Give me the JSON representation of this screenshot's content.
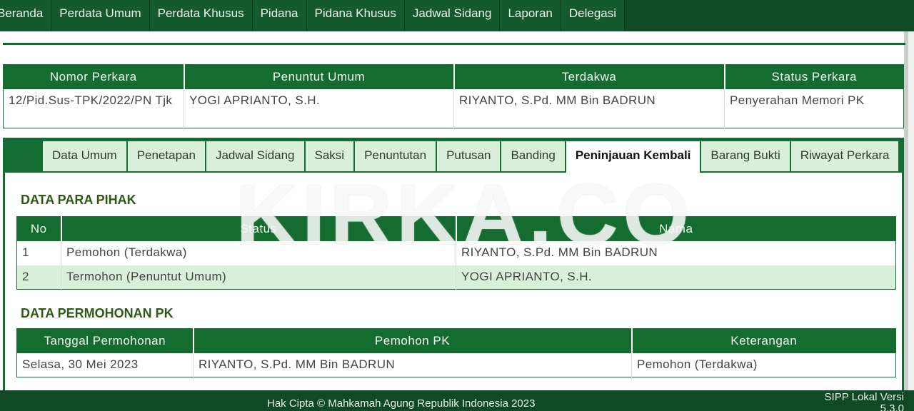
{
  "nav": {
    "items": [
      "Beranda",
      "Perdata Umum",
      "Perdata Khusus",
      "Pidana",
      "Pidana Khusus",
      "Jadwal Sidang",
      "Laporan",
      "Delegasi"
    ]
  },
  "case": {
    "headers": [
      "Nomor Perkara",
      "Penuntut Umum",
      "Terdakwa",
      "Status Perkara"
    ],
    "row": [
      "12/Pid.Sus-TPK/2022/PN Tjk",
      "YOGI APRIANTO, S.H.",
      "RIYANTO, S.Pd. MM Bin BADRUN",
      "Penyerahan Memori PK"
    ]
  },
  "tabs": {
    "items": [
      "Data Umum",
      "Penetapan",
      "Jadwal Sidang",
      "Saksi",
      "Penuntutan",
      "Putusan",
      "Banding",
      "Peninjauan Kembali",
      "Barang Bukti",
      "Riwayat Perkara"
    ],
    "active": "Peninjauan Kembali"
  },
  "parties": {
    "title": "DATA PARA PIHAK",
    "headers": [
      "No",
      "Status",
      "Nama"
    ],
    "rows": [
      [
        "1",
        "Pemohon (Terdakwa)",
        "RIYANTO, S.Pd. MM Bin BADRUN"
      ],
      [
        "2",
        "Termohon (Penuntut Umum)",
        "YOGI APRIANTO, S.H."
      ]
    ]
  },
  "pk": {
    "title": "DATA PERMOHONAN PK",
    "headers": [
      "Tanggal Permohonan",
      "Pemohon PK",
      "Keterangan"
    ],
    "rows": [
      [
        "Selasa, 30 Mei 2023",
        "RIYANTO, S.Pd. MM Bin BADRUN",
        "Pemohon (Terdakwa)"
      ]
    ]
  },
  "watermark": "KIRKA.CO",
  "footer": {
    "copyright": "Hak Cipta © Mahkamah Agung Republik Indonesia 2023",
    "version_label": "SIPP Lokal Versi",
    "version_number": "5.3.0"
  },
  "colors": {
    "nav_bg": "#0f4a24",
    "header_green": "#146c31",
    "tab_inactive": "#d9efd9",
    "section_title": "#2c5a16"
  }
}
